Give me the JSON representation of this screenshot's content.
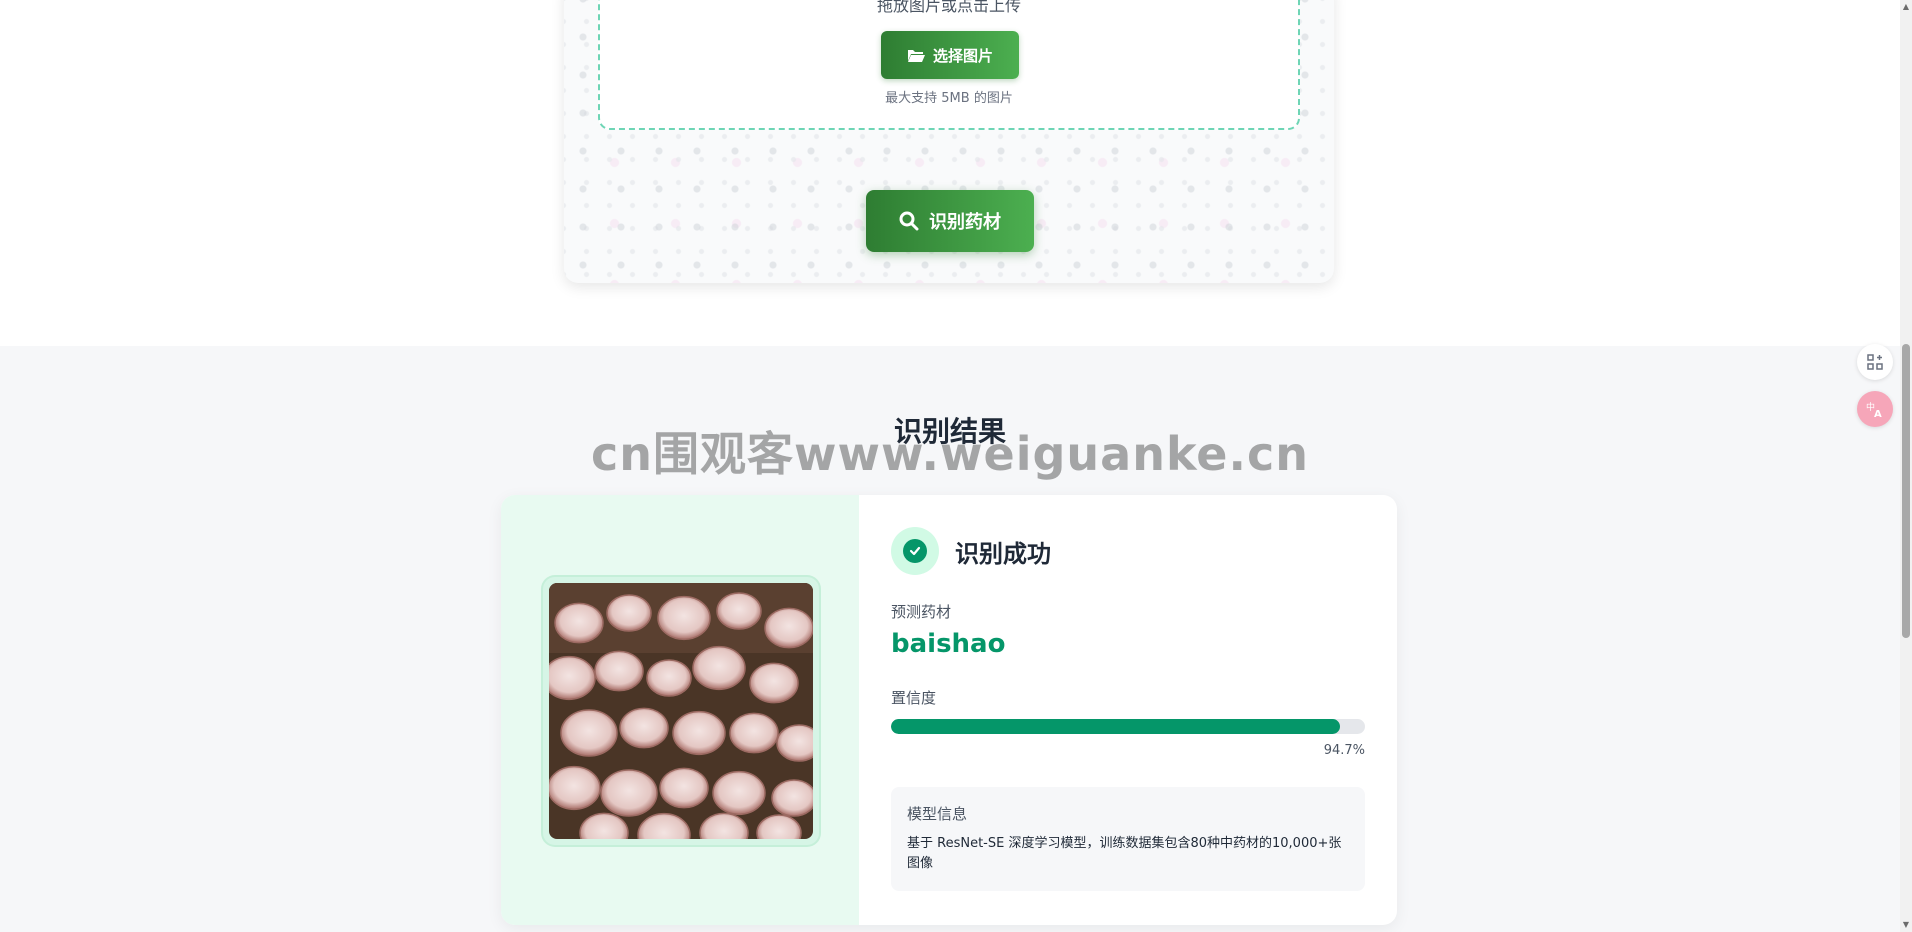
{
  "upload": {
    "drop_text": "拖放图片或点击上传",
    "choose_button": "选择图片",
    "limit_text": "最大支持 5MB 的图片",
    "identify_button": "识别药材"
  },
  "results": {
    "title": "识别结果",
    "watermark": "cn围观客www.weiguanke.cn",
    "status": "识别成功",
    "prediction_label": "预测药材",
    "prediction_value": "baishao",
    "confidence_label": "置信度",
    "confidence_value": "94.7%",
    "confidence_fraction": 0.947,
    "model_info_title": "模型信息",
    "model_info_desc": "基于 ResNet-SE 深度学习模型，训练数据集包含80种中药材的10,000+张图像"
  },
  "icons": {
    "choose": "folder-open-icon",
    "identify": "search-icon",
    "status": "check-circle-icon",
    "side_top": "apps-add-icon",
    "side_bottom": "translate-icon"
  },
  "colors": {
    "primary_green": "#2e7d32",
    "accent_green": "#059669",
    "image_panel_bg": "#e8faf1",
    "dropzone_border": "#6ed5b5"
  }
}
